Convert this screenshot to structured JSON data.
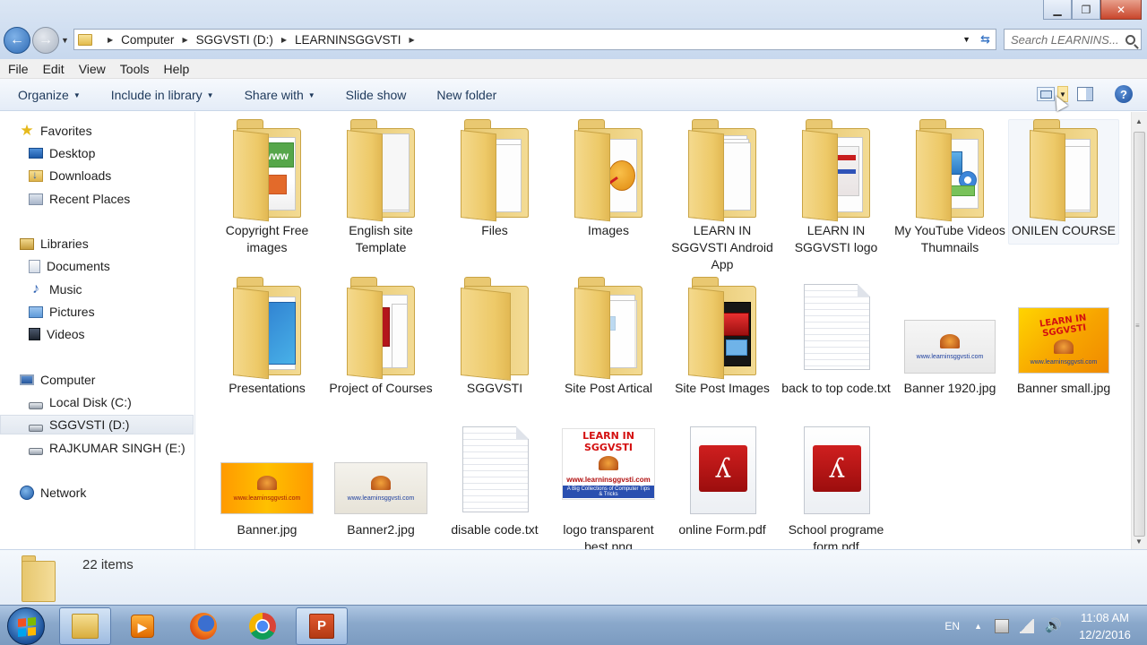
{
  "window": {
    "minimize": "▁",
    "maximize": "❐",
    "close": "✕"
  },
  "address": {
    "path": [
      "Computer",
      "SGGVSTI (D:)",
      "LEARNINSGGVSTI"
    ],
    "search_placeholder": "Search LEARNINS..."
  },
  "menu": [
    "File",
    "Edit",
    "View",
    "Tools",
    "Help"
  ],
  "commands": [
    {
      "label": "Organize",
      "dropdown": true
    },
    {
      "label": "Include in library",
      "dropdown": true
    },
    {
      "label": "Share with",
      "dropdown": true
    },
    {
      "label": "Slide show",
      "dropdown": false
    },
    {
      "label": "New folder",
      "dropdown": false
    }
  ],
  "nav": {
    "favorites": "Favorites",
    "desktop": "Desktop",
    "downloads": "Downloads",
    "recent": "Recent Places",
    "libraries": "Libraries",
    "documents": "Documents",
    "music": "Music",
    "pictures": "Pictures",
    "videos": "Videos",
    "computer": "Computer",
    "local_c": "Local Disk (C:)",
    "sggvsti_d": "SGGVSTI (D:)",
    "rajkumar_e": "RAJKUMAR SINGH (E:)",
    "network": "Network"
  },
  "items": {
    "copyright": "Copyright Free images",
    "english": "English site Template",
    "files": "Files",
    "images": "Images",
    "android": "LEARN IN SGGVSTI Android App",
    "logo": "LEARN IN SGGVSTI logo",
    "youtube": "My YouTube Videos Thumnails",
    "onilen": "ONILEN COURSE",
    "presentations": "Presentations",
    "project": "Project of Courses",
    "sggvsti": "SGGVSTI",
    "sitepost": "Site Post Artical",
    "siteimages": "Site Post Images",
    "backtotop": "back to top code.txt",
    "banner1920": "Banner 1920.jpg",
    "bannersmall": "Banner small.jpg",
    "banner": "Banner.jpg",
    "banner2": "Banner2.jpg",
    "disable": "disable code.txt",
    "logotrans": "logo transparent best.png",
    "onlineform": "online Form.pdf",
    "school": "School programe form.pdf"
  },
  "thumbs": {
    "www": "www",
    "brand": "LEARN IN SGGVSTI",
    "site": "www.learninsggvsti.com",
    "site_alt": "www.learninsggvsti.com",
    "tagline": "A Big Collections of Computer Tips & Tricks"
  },
  "details": {
    "count": "22 items"
  },
  "tray": {
    "lang": "EN",
    "time": "11:08 AM",
    "date": "12/2/2016"
  }
}
